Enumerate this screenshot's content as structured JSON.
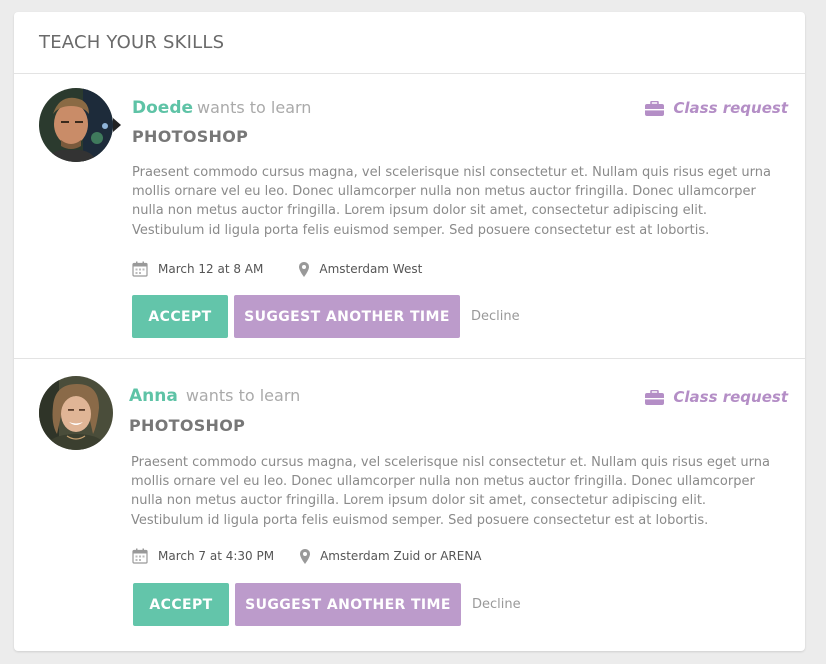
{
  "header": {
    "title": "TEACH YOUR SKILLS"
  },
  "requests": [
    {
      "learner": "Doede",
      "wants_text": "wants to learn",
      "skill": "PHOTOSHOP",
      "badge": "Class request",
      "description": "Praesent commodo cursus magna, vel scelerisque nisl consectetur et. Nullam quis risus eget urna mollis ornare vel eu leo. Donec ullamcorper nulla non metus auctor fringilla. Donec ullamcorper nulla non metus auctor fringilla. Lorem ipsum dolor sit amet, consectetur adipiscing elit. Vestibulum id ligula porta felis euismod semper. Sed posuere consectetur est at lobortis.",
      "date": "March 12 at 8 AM",
      "location": "Amsterdam West",
      "accept_label": "ACCEPT",
      "suggest_label": "SUGGEST ANOTHER TIME",
      "decline_label": "Decline"
    },
    {
      "learner": "Anna",
      "wants_text": "wants to learn",
      "skill": "PHOTOSHOP",
      "badge": "Class request",
      "description": "Praesent commodo cursus magna, vel scelerisque nisl consectetur et. Nullam quis risus eget urna mollis ornare vel eu leo. Donec ullamcorper nulla non metus auctor fringilla. Donec ullamcorper nulla non metus auctor fringilla. Lorem ipsum dolor sit amet, consectetur adipiscing elit. Vestibulum id ligula porta felis euismod semper. Sed posuere consectetur est at lobortis.",
      "date": "March 7 at 4:30 PM",
      "location": "Amsterdam Zuid or ARENA",
      "accept_label": "ACCEPT",
      "suggest_label": "SUGGEST ANOTHER TIME",
      "decline_label": "Decline"
    }
  ],
  "colors": {
    "accent_green": "#63c5aa",
    "accent_purple": "#bc9bcb",
    "name_green": "#5ec3a6",
    "badge_purple": "#b48ec6"
  },
  "icons": {
    "badge": "briefcase-icon",
    "date": "calendar-icon",
    "location": "map-pin-icon"
  }
}
